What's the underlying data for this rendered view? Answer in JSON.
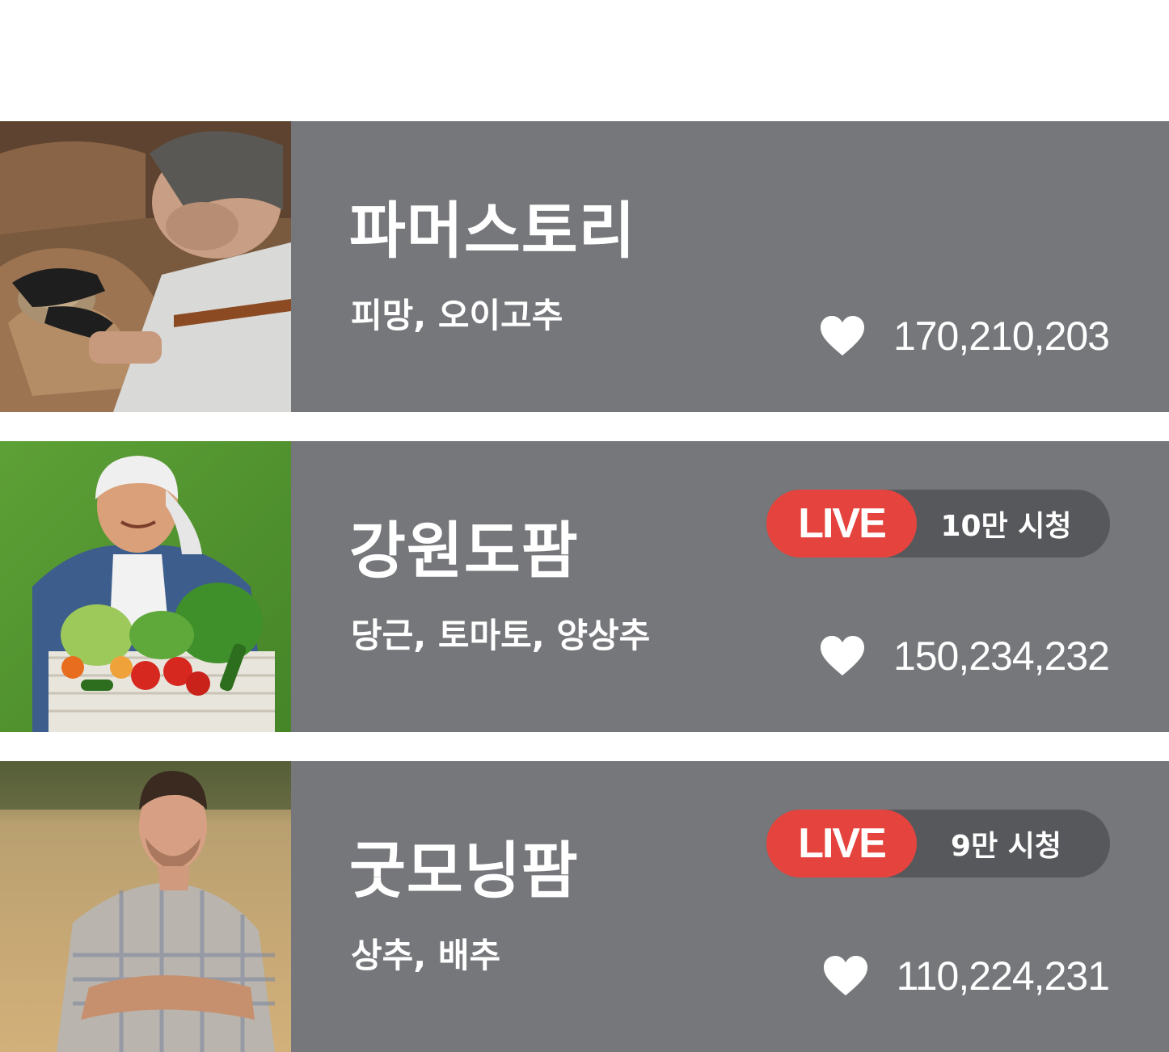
{
  "farms": [
    {
      "name": "파머스토리",
      "products": "피망, 오이고추",
      "likes": "170,210,203",
      "live": null
    },
    {
      "name": "강원도팜",
      "products": "당근, 토마토, 양상추",
      "likes": "150,234,232",
      "live": {
        "badge": "LIVE",
        "viewers": "10만 시청"
      }
    },
    {
      "name": "굿모닝팜",
      "products": "상추, 배추",
      "likes": "110,224,231",
      "live": {
        "badge": "LIVE",
        "viewers": "9만 시청"
      }
    }
  ],
  "colors": {
    "card_bg": "#76777b",
    "live_red": "#e5443e",
    "pill_bg": "#57585c",
    "text": "#ffffff"
  }
}
